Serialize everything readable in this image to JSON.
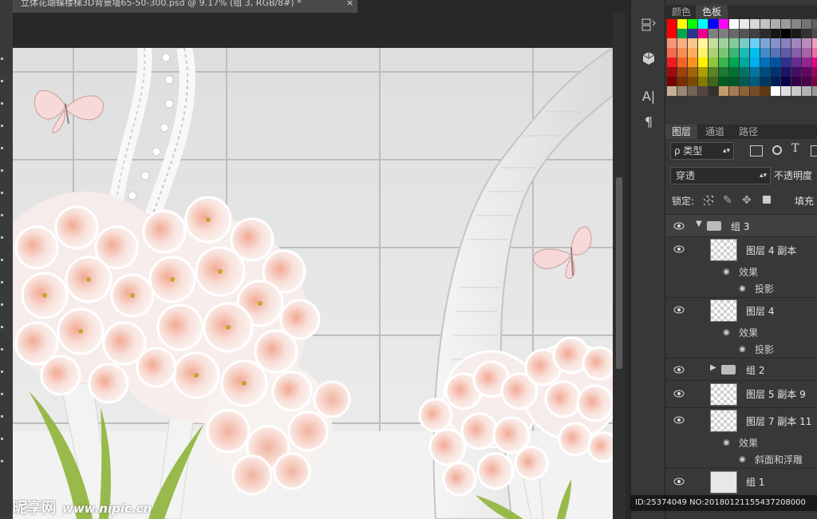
{
  "document": {
    "tab_title": "立体花瑚蝶楼梯3D背景墙65-50-300.psd @ 9.17% (组 3, RGB/8#) *",
    "close_glyph": "×"
  },
  "mid_toolbar": {
    "icons": [
      "history-icon",
      "3d-cube-icon",
      "character-icon",
      "paragraph-icon"
    ],
    "character_glyph": "A|",
    "paragraph_glyph": "¶"
  },
  "swatch_panel": {
    "tabs": [
      "颜色",
      "色板"
    ],
    "active_tab": "色板"
  },
  "layers_panel": {
    "tabs": [
      "图层",
      "通道",
      "路径"
    ],
    "active_tab": "图层",
    "filter_kind": "ρ 类型",
    "blend_mode": "穿透",
    "opacity_label": "不透明度",
    "lock_label": "锁定:",
    "fill_label": "填充",
    "layers": [
      {
        "name": "组 3",
        "type": "group-open",
        "selected": true
      },
      {
        "name": "图层 4 副本",
        "type": "layer",
        "effects_label": "效果",
        "effects": [
          "投影"
        ]
      },
      {
        "name": "图层 4",
        "type": "layer",
        "effects_label": "效果",
        "effects": [
          "投影"
        ]
      },
      {
        "name": "组 2",
        "type": "group-closed"
      },
      {
        "name": "图层 5 副本 9",
        "type": "layer"
      },
      {
        "name": "图层 7 副本 11",
        "type": "layer",
        "effects_label": "效果",
        "effects": [
          "斜面和浮雕"
        ]
      },
      {
        "name": "组 1",
        "type": "layer"
      }
    ]
  },
  "watermark": {
    "brand": "昵享网",
    "url": "www.nipic.cn"
  },
  "image_id": "ID:25374049 NO:20180121155437208000",
  "colors": {
    "panel_bg": "#383838",
    "canvas_wall": "#e4e4e4",
    "accent_pink": "#f2b9a8"
  }
}
